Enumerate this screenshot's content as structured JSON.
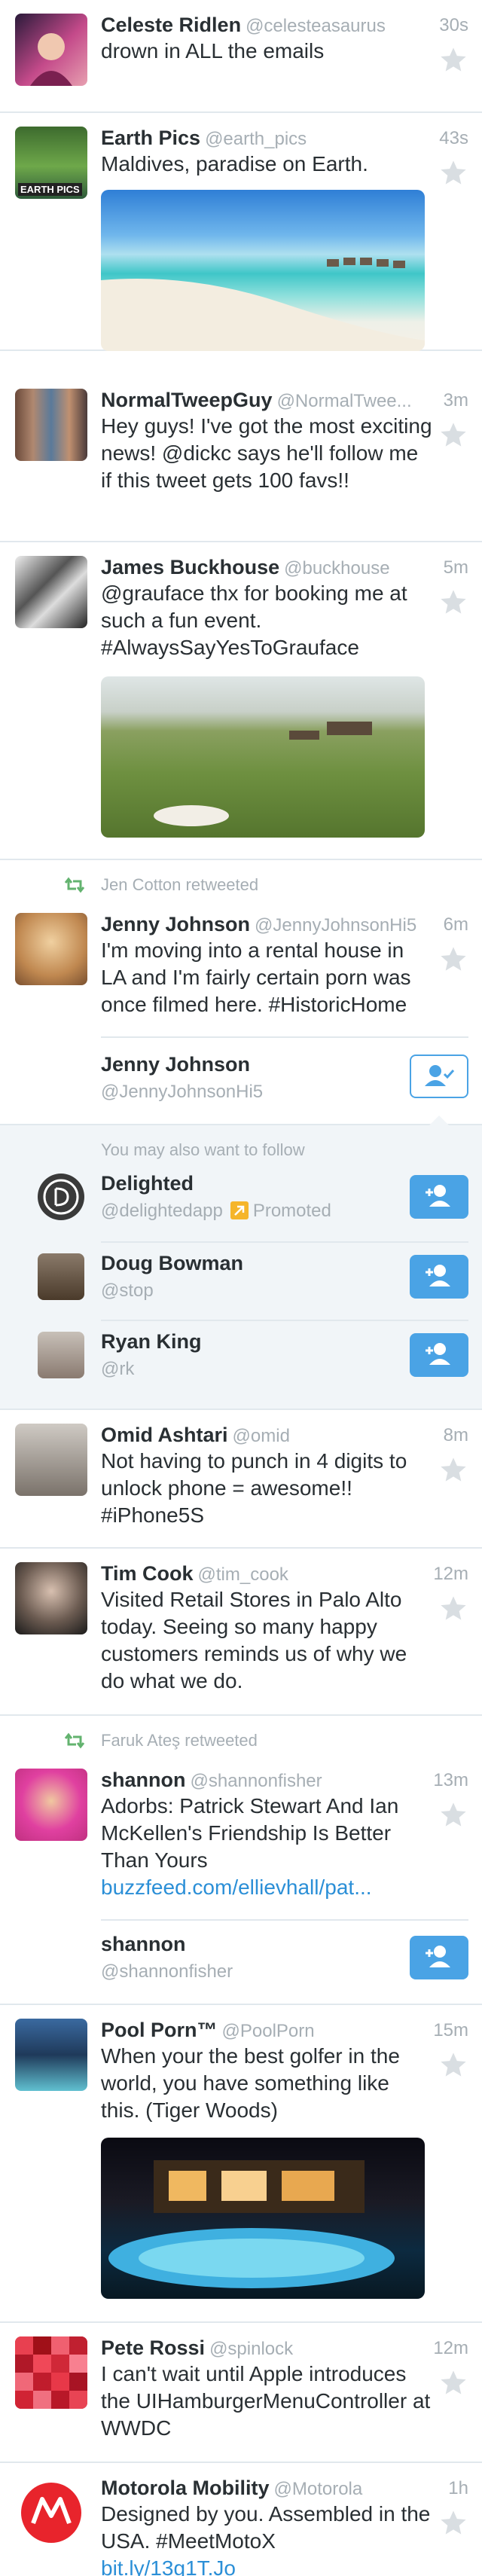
{
  "colors": {
    "accent": "#4aa3e5",
    "link": "#2b8fd7",
    "muted": "#a6aeb4",
    "retweet": "#63b36f",
    "promoted": "#f5b52a"
  },
  "tweets": [
    {
      "name": "Celeste Ridlen",
      "handle": "@celesteasaurus",
      "time": "30s",
      "text": "drown in ALL the emails"
    },
    {
      "name": "Earth Pics",
      "handle": "@earth_pics",
      "time": "43s",
      "text": "Maldives, paradise on Earth.",
      "avatar_label": "EARTH PICS"
    },
    {
      "name": "NormalTweepGuy",
      "handle": "@NormalTwee...",
      "time": "3m",
      "text": "Hey guys! I've got the most exciting news! @dickc says he'll follow me if this tweet gets 100 favs!!"
    },
    {
      "name": "James Buckhouse",
      "handle": "@buckhouse",
      "time": "5m",
      "text": "@grauface thx for booking me at such a fun event. #AlwaysSayYesToGrauface"
    },
    {
      "retweeted_by": "Jen Cotton retweeted",
      "name": "Jenny Johnson",
      "handle": "@JennyJohnsonHi5",
      "time": "6m",
      "text": "I'm moving into a rental house in LA and I'm fairly certain porn was once filmed here. #HistoricHome",
      "card_name": "Jenny Johnson",
      "card_handle": "@JennyJohnsonHi5"
    },
    {
      "name": "Omid Ashtari",
      "handle": "@omid",
      "time": "8m",
      "text": "Not having to punch in 4 digits to unlock phone = awesome!! #iPhone5S"
    },
    {
      "name": "Tim Cook",
      "handle": "@tim_cook",
      "time": "12m",
      "text": "Visited Retail Stores in Palo Alto today. Seeing so many happy customers reminds us of why we do what we do."
    },
    {
      "retweeted_by": "Faruk Ateş retweeted",
      "name": "shannon",
      "handle": "@shannonfisher",
      "time": "13m",
      "text": "Adorbs: Patrick Stewart And Ian McKellen's Friendship Is Better Than Yours",
      "link": "buzzfeed.com/ellievhall/pat...",
      "card_name": "shannon",
      "card_handle": "@shannonfisher"
    },
    {
      "name": "Pool Porn™",
      "handle": "@PoolPorn",
      "time": "15m",
      "text": "When your the best golfer in the world, you have something like this. (Tiger Woods)"
    },
    {
      "name": "Pete Rossi",
      "handle": "@spinlock",
      "time": "12m",
      "text": "I can't wait until Apple introduces the UIHamburgerMenuController at WWDC"
    },
    {
      "name": "Motorola Mobility",
      "handle": "@Motorola",
      "time": "1h",
      "text": "Designed by you. Assembled in the USA. #MeetMotoX",
      "link": "bit.ly/13g1T.Jo"
    }
  ],
  "suggestions": {
    "heading": "You may also want to follow",
    "items": [
      {
        "name": "Delighted",
        "handle": "@delightedapp",
        "promoted": "Promoted"
      },
      {
        "name": "Doug Bowman",
        "handle": "@stop"
      },
      {
        "name": "Ryan King",
        "handle": "@rk"
      }
    ]
  }
}
